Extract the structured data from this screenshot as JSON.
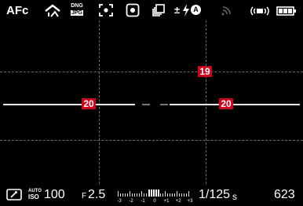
{
  "top_bar": {
    "focus_mode": "AFc",
    "file_format_top": "DNG",
    "file_format_bottom": "JPG",
    "exposure_comp_symbol": "±",
    "flash_mode_label": "A"
  },
  "horizon": {
    "pitch_value": "19",
    "roll_left_value": "20",
    "roll_right_value": "20"
  },
  "bottom_bar": {
    "iso_label_top": "AUTO",
    "iso_label_bottom": "ISO",
    "iso_value": "100",
    "aperture_prefix": "F",
    "aperture_value": "2.5",
    "scale_labels": [
      "-3",
      "-2",
      "-1",
      "0",
      "+1",
      "+2",
      "+3"
    ],
    "shutter_speed": "1/125",
    "shutter_unit": "s",
    "shots_remaining": "623"
  },
  "icons": [
    "scene-mode-icon",
    "file-format-icon",
    "metering-spot-icon",
    "metering-center-icon",
    "drive-mode-icon",
    "flash-icon",
    "wifi-icon",
    "stabilization-icon",
    "battery-icon",
    "exposure-mode-icon"
  ],
  "colors": {
    "level_indicator": "#d0021b",
    "background": "#000000",
    "text": "#ffffff"
  }
}
